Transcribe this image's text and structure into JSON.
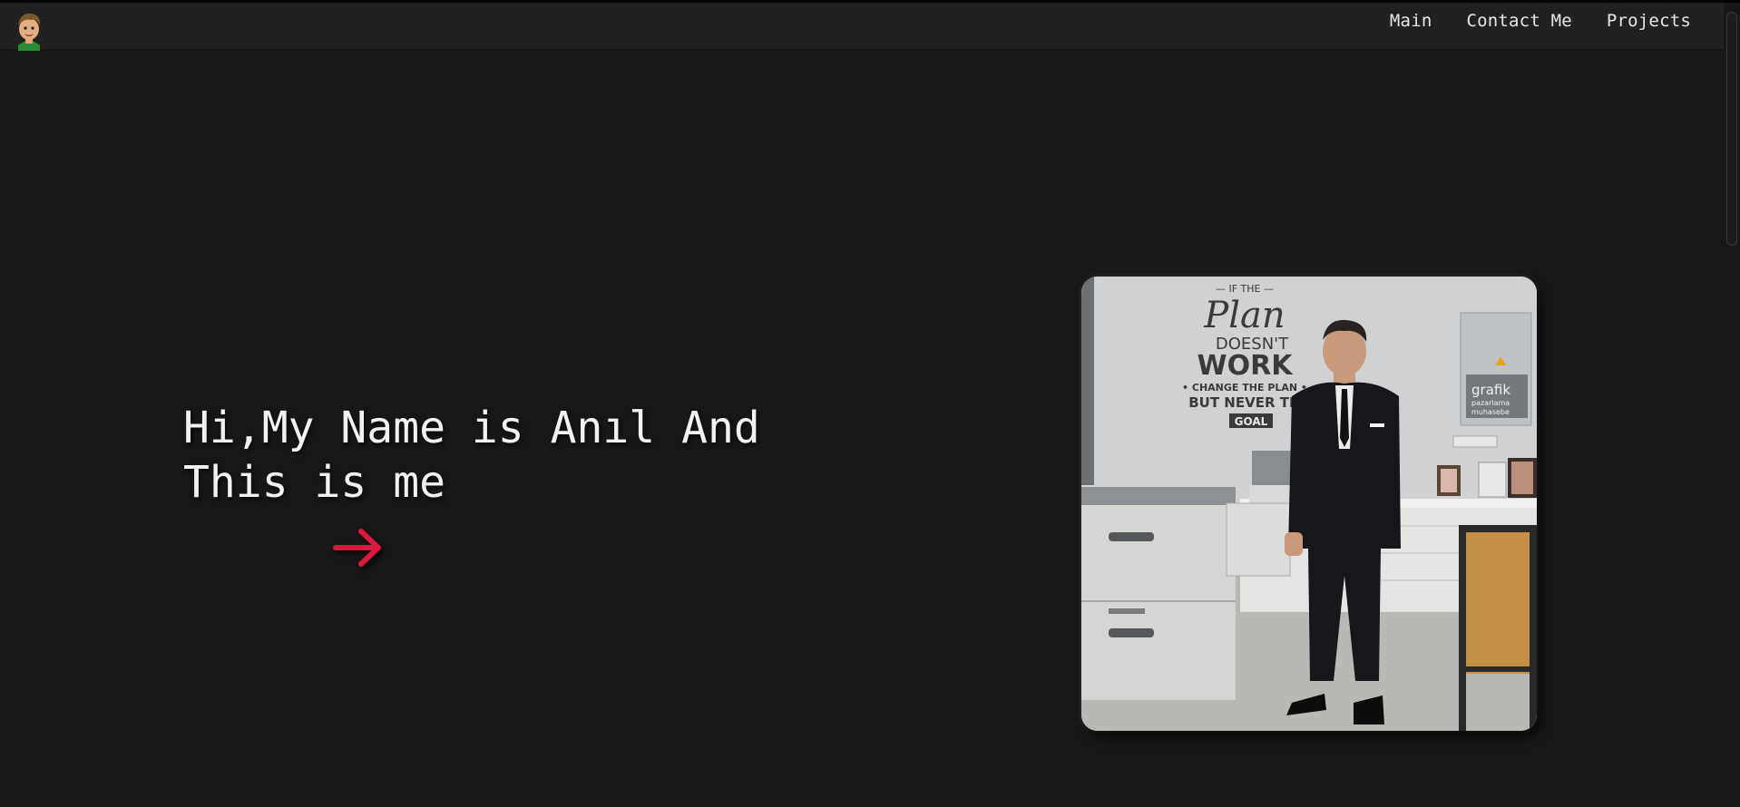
{
  "nav": {
    "links": [
      "Main",
      "Contact Me",
      "Projects"
    ]
  },
  "hero": {
    "line1": "Hi,My Name is Anıl And",
    "line2": "This is me",
    "arrow_color": "#e0163f"
  },
  "photo": {
    "poster": {
      "line1": "— IF THE —",
      "line2": "Plan",
      "line3": "DOESN'T",
      "line4": "WORK",
      "line5": "• CHANGE THE PLAN •",
      "line6": "BUT NEVER THE",
      "line7": "GOAL"
    },
    "sign": {
      "line1": "grafik",
      "line2": "pazarlama",
      "line3": "muhasebe"
    }
  },
  "colors": {
    "background": "#171717",
    "navbar": "#212121",
    "text": "#f2f2f2",
    "accent": "#e0163f"
  }
}
